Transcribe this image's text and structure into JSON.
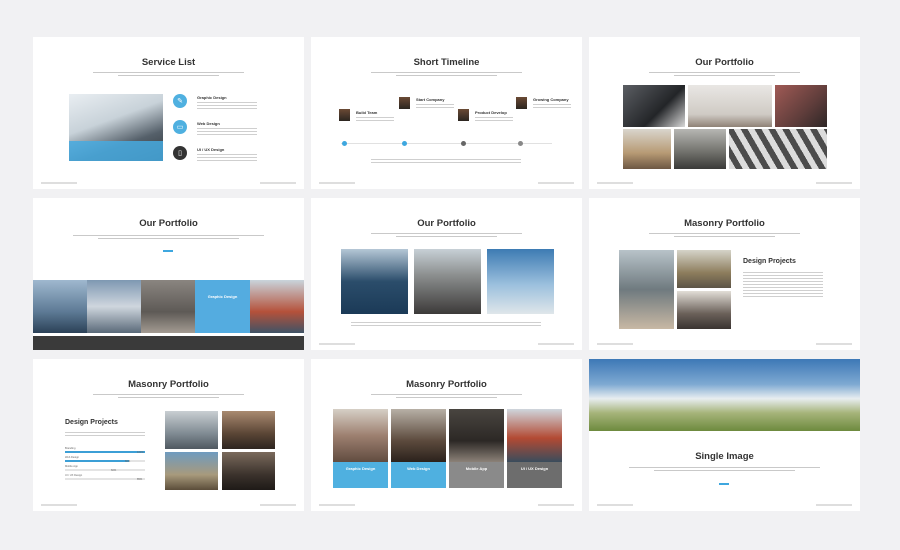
{
  "slides": [
    {
      "title": "Service List",
      "services": [
        {
          "label": "Graphic Design",
          "icon": "palette-icon"
        },
        {
          "label": "Web Design",
          "icon": "monitor-icon"
        },
        {
          "label": "UI / UX Design",
          "icon": "phone-icon"
        }
      ]
    },
    {
      "title": "Short Timeline",
      "events": [
        "Build Team",
        "Start Company",
        "Product Develop",
        "Growing Company"
      ]
    },
    {
      "title": "Our Portfolio"
    },
    {
      "title": "Our Portfolio",
      "tile_label": "Graphic Design"
    },
    {
      "title": "Our Portfolio"
    },
    {
      "title": "Masonry Portfolio",
      "heading": "Design Projects"
    },
    {
      "title": "Masonry Portfolio",
      "heading": "Design Projects",
      "skills": [
        {
          "label": "Branding",
          "percent": 100,
          "value_label": "100%"
        },
        {
          "label": "Web Design",
          "percent": 80,
          "value_label": "80%"
        },
        {
          "label": "Mobile App",
          "percent": 60,
          "value_label": "60%"
        },
        {
          "label": "UI / UX Design",
          "percent": 85,
          "value_label": "85%"
        }
      ]
    },
    {
      "title": "Masonry Portfolio",
      "cards": [
        "Graphic Design",
        "Web Design",
        "Mobile App",
        "UI / UX Design"
      ]
    },
    {
      "title": "Single Image"
    }
  ]
}
